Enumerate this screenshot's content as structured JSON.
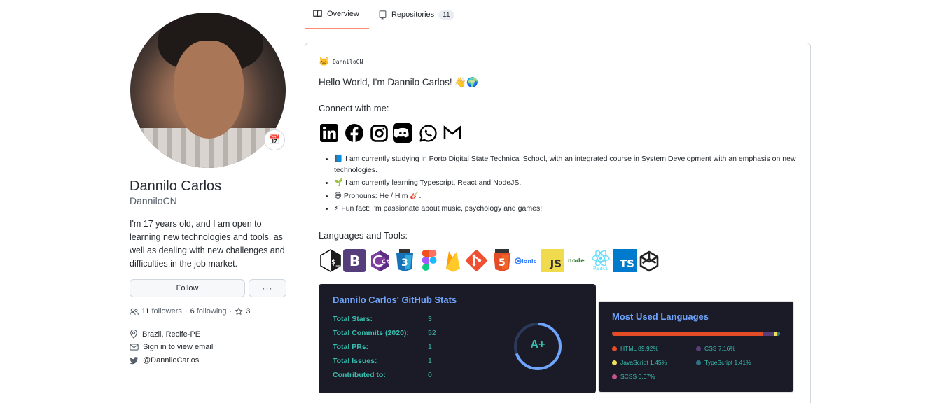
{
  "tabs": {
    "overview": "Overview",
    "repositories": "Repositories",
    "repositories_count": "11"
  },
  "profile": {
    "name": "Dannilo Carlos",
    "login": "DanniloCN",
    "bio": "I'm 17 years old, and I am open to learning new technologies and tools, as well as dealing with new challenges and difficulties in the job market.",
    "follow_label": "Follow",
    "more_label": "···",
    "followers_count": "11",
    "followers_label": "followers",
    "following_count": "6",
    "following_label": "following",
    "stars_count": "3",
    "location": "Brazil, Recife-PE",
    "email": "Sign in to view email",
    "twitter": "@DanniloCarlos"
  },
  "readme": {
    "header": "DanniloCN",
    "hello": "Hello World, I'm Dannilo Carlos! 👋🌍",
    "connect": "Connect with me:",
    "bullets": [
      "📘 I am currently studying in Porto Digital State Technical School, with an integrated course in System Development with an emphasis on new technologies.",
      "🌱 I am currently learning Typescript, React and NodeJS.",
      "😄 Pronouns: He / Him 🎸.",
      "⚡ Fun fact: I'm passionate about music, psychology and games!"
    ],
    "languages_heading": "Languages and Tools:",
    "tools": [
      {
        "icon": "bash-icon",
        "label": "$_"
      },
      {
        "icon": "bootstrap-icon",
        "label": "B"
      },
      {
        "icon": "csharp-icon",
        "label": "C#"
      },
      {
        "icon": "css3-icon",
        "label": "3"
      },
      {
        "icon": "figma-icon",
        "label": ""
      },
      {
        "icon": "firebase-icon",
        "label": ""
      },
      {
        "icon": "git-icon",
        "label": ""
      },
      {
        "icon": "html5-icon",
        "label": "5"
      },
      {
        "icon": "ionic-icon",
        "label": "ionic"
      },
      {
        "icon": "javascript-icon",
        "label": "JS"
      },
      {
        "icon": "nodejs-icon",
        "label": "node"
      },
      {
        "icon": "react-icon",
        "label": "React"
      },
      {
        "icon": "typescript-icon",
        "label": "TS"
      },
      {
        "icon": "unity-icon",
        "label": ""
      }
    ]
  },
  "stats": {
    "title": "Dannilo Carlos' GitHub Stats",
    "rows": [
      {
        "label": "Total Stars:",
        "value": "3"
      },
      {
        "label": "Total Commits (2020):",
        "value": "52"
      },
      {
        "label": "Total PRs:",
        "value": "1"
      },
      {
        "label": "Total Issues:",
        "value": "1"
      },
      {
        "label": "Contributed to:",
        "value": "0"
      }
    ],
    "grade": "A+"
  },
  "languages": {
    "title": "Most Used Languages",
    "items": [
      {
        "label": "HTML 89.92%",
        "color": "#e34c26",
        "share": 89.92
      },
      {
        "label": "CSS 7.16%",
        "color": "#563d7c",
        "share": 7.16
      },
      {
        "label": "JavaScript 1.45%",
        "color": "#f1e05a",
        "share": 1.45
      },
      {
        "label": "TypeScript 1.41%",
        "color": "#2b7489",
        "share": 1.41
      },
      {
        "label": "SCSS 0.07%",
        "color": "#c6538c",
        "share": 0.07
      }
    ]
  }
}
